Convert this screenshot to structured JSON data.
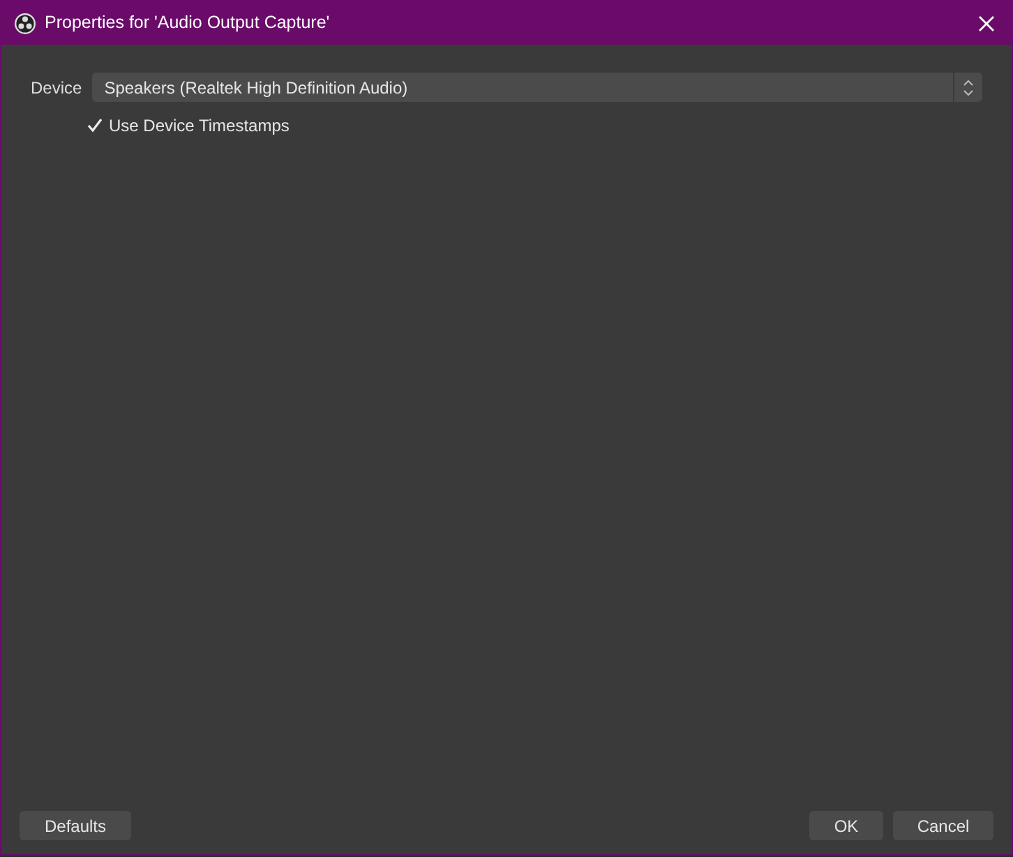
{
  "window": {
    "title": "Properties for 'Audio Output Capture'"
  },
  "device": {
    "label": "Device",
    "value": "Speakers (Realtek High Definition Audio)"
  },
  "timestamps": {
    "label": "Use Device Timestamps",
    "checked": true
  },
  "buttons": {
    "left": [
      "Defaults"
    ],
    "right": [
      "OK",
      "Cancel"
    ]
  }
}
